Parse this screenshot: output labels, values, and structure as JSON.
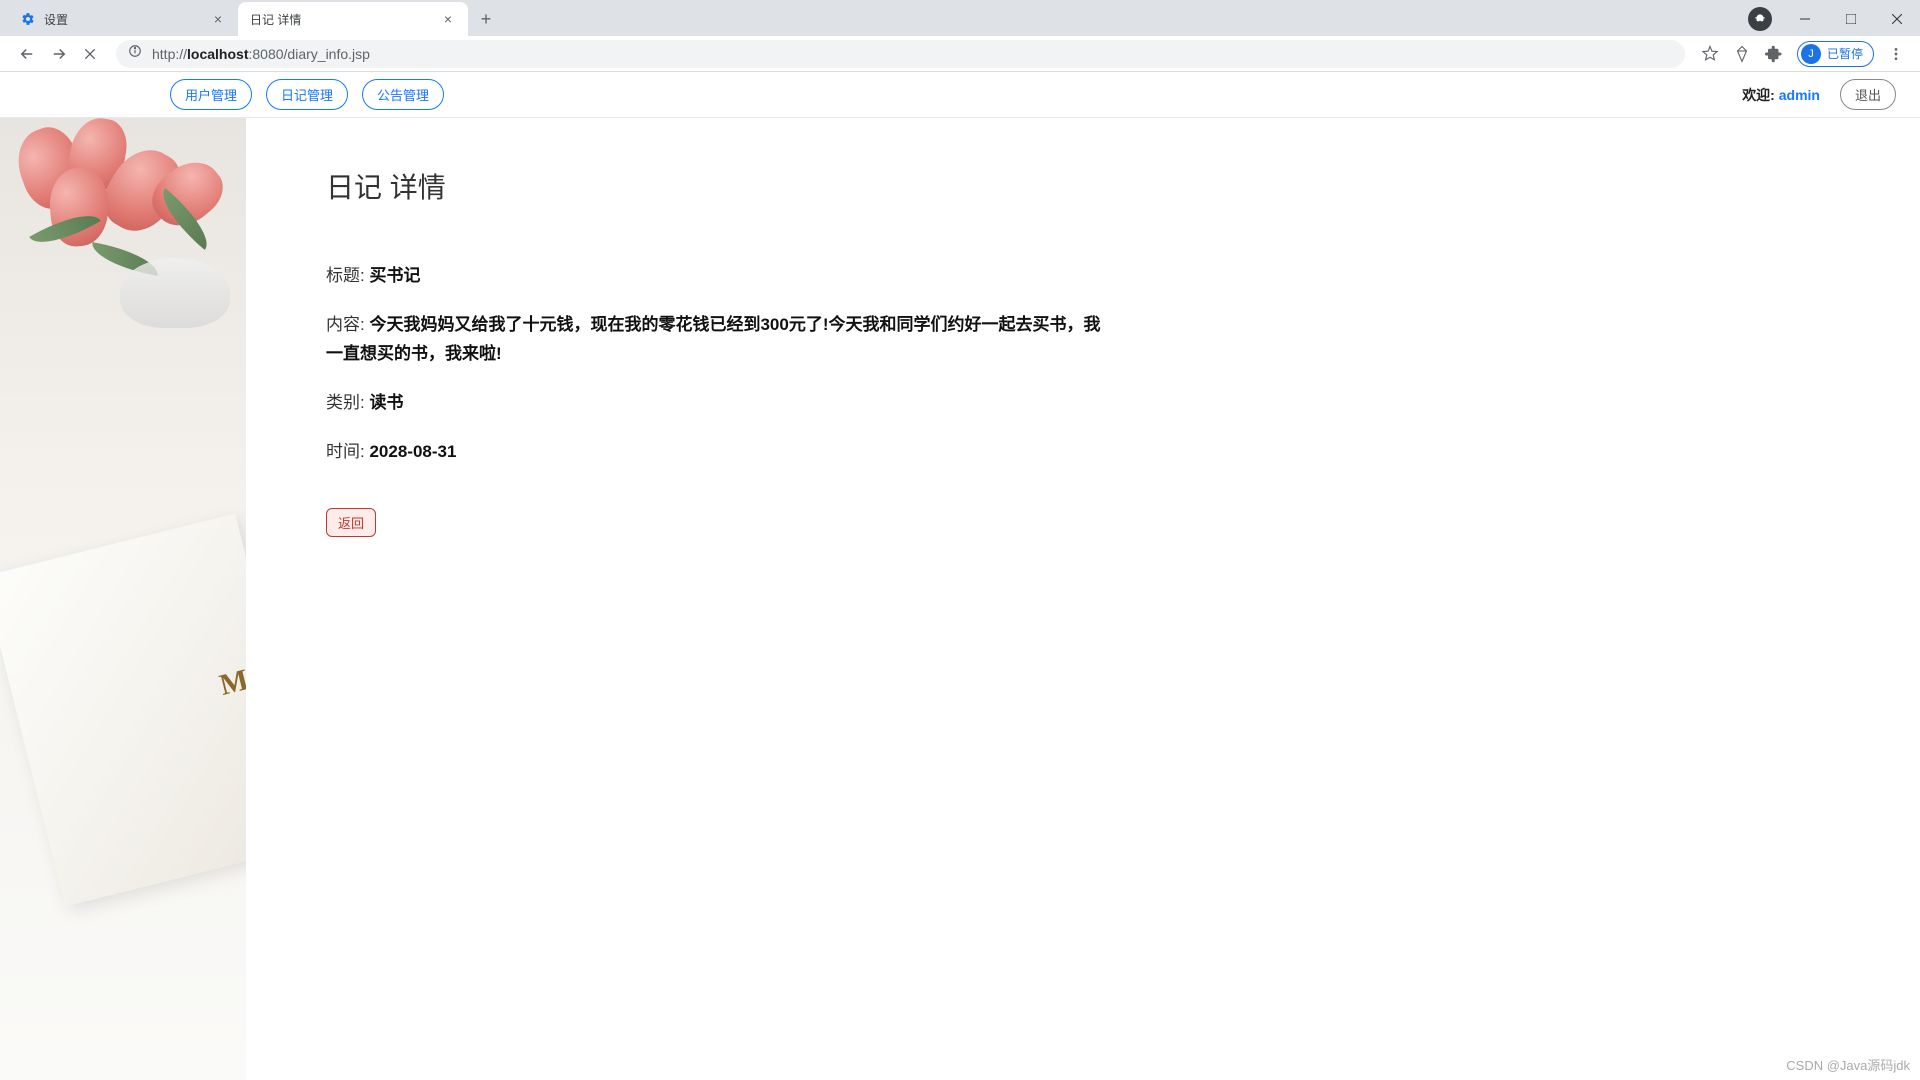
{
  "browser": {
    "tabs": [
      {
        "title": "设置",
        "active": false,
        "icon": "gear"
      },
      {
        "title": "日记 详情",
        "active": true,
        "icon": "none"
      }
    ],
    "url_prefix": "http://",
    "url_host": "localhost",
    "url_port": ":8080",
    "url_path": "/diary_info.jsp",
    "ext_badge": {
      "initial": "J",
      "label": "已暂停"
    }
  },
  "topbar": {
    "nav": [
      {
        "label": "用户管理"
      },
      {
        "label": "日记管理"
      },
      {
        "label": "公告管理"
      }
    ],
    "welcome_label": "欢迎:",
    "welcome_user": "admin",
    "logout_label": "退出"
  },
  "page": {
    "title": "日记 详情",
    "fields": {
      "title_label": "标题:",
      "title_value": "买书记",
      "content_label": "内容:",
      "content_value": "今天我妈妈又给我了十元钱，现在我的零花钱已经到300元了!今天我和同学们约好一起去买书，我一直想买的书，我来啦!",
      "category_label": "类别:",
      "category_value": "读书",
      "time_label": "时间:",
      "time_value": "2028-08-31"
    },
    "back_label": "返回"
  },
  "watermark": "CSDN @Java源码jdk",
  "side_book_letter": "M"
}
